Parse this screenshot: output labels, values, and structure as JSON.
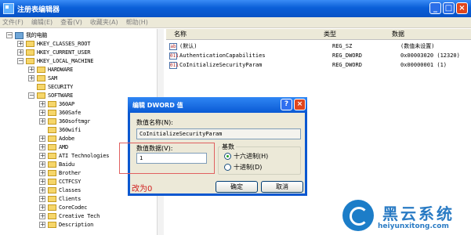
{
  "window": {
    "title": "注册表编辑器"
  },
  "menu": [
    "文件(F)",
    "编辑(E)",
    "查看(V)",
    "收藏夹(A)",
    "帮助(H)"
  ],
  "tree": {
    "root": "我的电脑",
    "items": [
      "HKEY_CLASSES_ROOT",
      "HKEY_CURRENT_USER",
      "HKEY_LOCAL_MACHINE",
      "HARDWARE",
      "SAM",
      "SECURITY",
      "SOFTWARE",
      "360AP",
      "360Safe",
      "360softmgr",
      "360wifi",
      "Adobe",
      "AMD",
      "ATI Technologies",
      "Baidu",
      "Brother",
      "CCTFCSY",
      "Classes",
      "Clients",
      "CoreCodec",
      "Creative Tech",
      "Description"
    ]
  },
  "list": {
    "headers": {
      "name": "名称",
      "type": "类型",
      "data": "数据"
    },
    "rows": [
      {
        "icon": "ab",
        "name": "(默认)",
        "type": "REG_SZ",
        "data": "(数值未设置)"
      },
      {
        "icon": "011",
        "name": "AuthenticationCapabilities",
        "type": "REG_DWORD",
        "data": "0x00003020 (12320)"
      },
      {
        "icon": "011",
        "name": "CoInitializeSecurityParam",
        "type": "REG_DWORD",
        "data": "0x00000001 (1)"
      }
    ]
  },
  "dialog": {
    "title": "编辑 DWORD 值",
    "name_label": "数值名称(N):",
    "name_value": "CoInitializeSecurityParam",
    "data_label": "数值数据(V):",
    "data_value": "1",
    "base_label": "基数",
    "radio_hex": "十六进制(H)",
    "radio_dec": "十进制(D)",
    "ok": "确定",
    "cancel": "取消"
  },
  "annotation": "改为0",
  "watermark": {
    "title": "黑云系统",
    "url": "heiyunxitong.com"
  },
  "colors": {
    "titlebar": "#0a5fd8",
    "annotation": "#d02020",
    "watermark": "#2a7bc4"
  }
}
